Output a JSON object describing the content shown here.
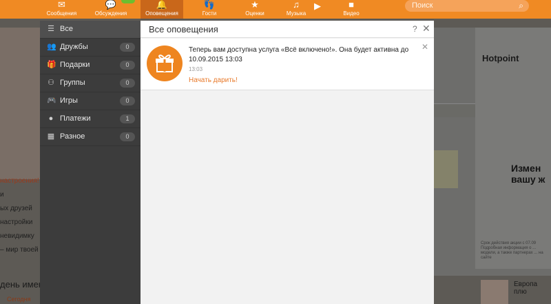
{
  "nav": {
    "items": [
      {
        "label": "Сообщения",
        "icon": "envelope-icon"
      },
      {
        "label": "Обсуждения",
        "icon": "chat-icon"
      },
      {
        "label": "Оповещения",
        "icon": "bell-icon"
      },
      {
        "label": "Гости",
        "icon": "footprints-icon"
      },
      {
        "label": "Оценки",
        "icon": "rating-icon"
      },
      {
        "label": "Музыка",
        "icon": "music-icon"
      },
      {
        "label": "Видео",
        "icon": "video-icon"
      }
    ],
    "search_placeholder": "Поиск"
  },
  "background": {
    "left_lines": [
      "настроения!",
      "и",
      "ых друзей",
      "настройки",
      "невидимку",
      "– мир твоей м"
    ],
    "bottom_text": "день имен",
    "bottom_link": "Сегодня",
    "ad_brand": "Hotpoint",
    "ad_headline": "Измен вашу ж",
    "ad_fine_print": "Срок действия акции с 07.09 Подробная информация о ... модели, а также партнерах ... на сайте",
    "right_news_title": "Европа плю"
  },
  "categories": [
    {
      "label": "Все",
      "icon": "list-icon",
      "count": ""
    },
    {
      "label": "Дружбы",
      "icon": "friends-icon",
      "count": "0"
    },
    {
      "label": "Подарки",
      "icon": "gift-icon",
      "count": "0"
    },
    {
      "label": "Группы",
      "icon": "groups-icon",
      "count": "0"
    },
    {
      "label": "Игры",
      "icon": "gamepad-icon",
      "count": "0"
    },
    {
      "label": "Платежи",
      "icon": "coin-icon",
      "count": "1"
    },
    {
      "label": "Разное",
      "icon": "misc-icon",
      "count": "0"
    }
  ],
  "notifications": {
    "title": "Все оповещения",
    "help": "?",
    "close": "✕",
    "items": [
      {
        "icon": "gift-icon",
        "text": "Теперь вам доступна услуга «Всё включено!». Она будет активна до 10.09.2015 13:03",
        "time": "13:03",
        "action": "Начать дарить!",
        "close": "✕"
      }
    ]
  },
  "colors": {
    "brand_orange": "#f08a23",
    "active_tab": "#c9671a",
    "link_orange": "#e8792a"
  }
}
